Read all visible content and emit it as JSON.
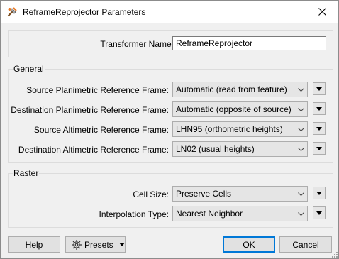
{
  "window": {
    "title": "ReframeReprojector Parameters",
    "icon": "transformer-wrench-icon"
  },
  "transformer_name": {
    "label": "Transformer Name:",
    "value": "ReframeReprojector"
  },
  "general": {
    "title": "General",
    "rows": [
      {
        "label": "Source Planimetric Reference Frame:",
        "value": "Automatic (read from feature)"
      },
      {
        "label": "Destination Planimetric Reference Frame:",
        "value": "Automatic (opposite of source)"
      },
      {
        "label": "Source Altimetric Reference Frame:",
        "value": "LHN95 (orthometric heights)"
      },
      {
        "label": "Destination Altimetric Reference Frame:",
        "value": "LN02 (usual heights)"
      }
    ]
  },
  "raster": {
    "title": "Raster",
    "rows": [
      {
        "label": "Cell Size:",
        "value": "Preserve Cells"
      },
      {
        "label": "Interpolation Type:",
        "value": "Nearest Neighbor"
      }
    ]
  },
  "buttons": {
    "help": "Help",
    "presets": "Presets",
    "ok": "OK",
    "cancel": "Cancel"
  },
  "colors": {
    "window_bg": "#f0f0f0",
    "titlebar_bg": "#ffffff",
    "default_button_border": "#0078d7"
  }
}
